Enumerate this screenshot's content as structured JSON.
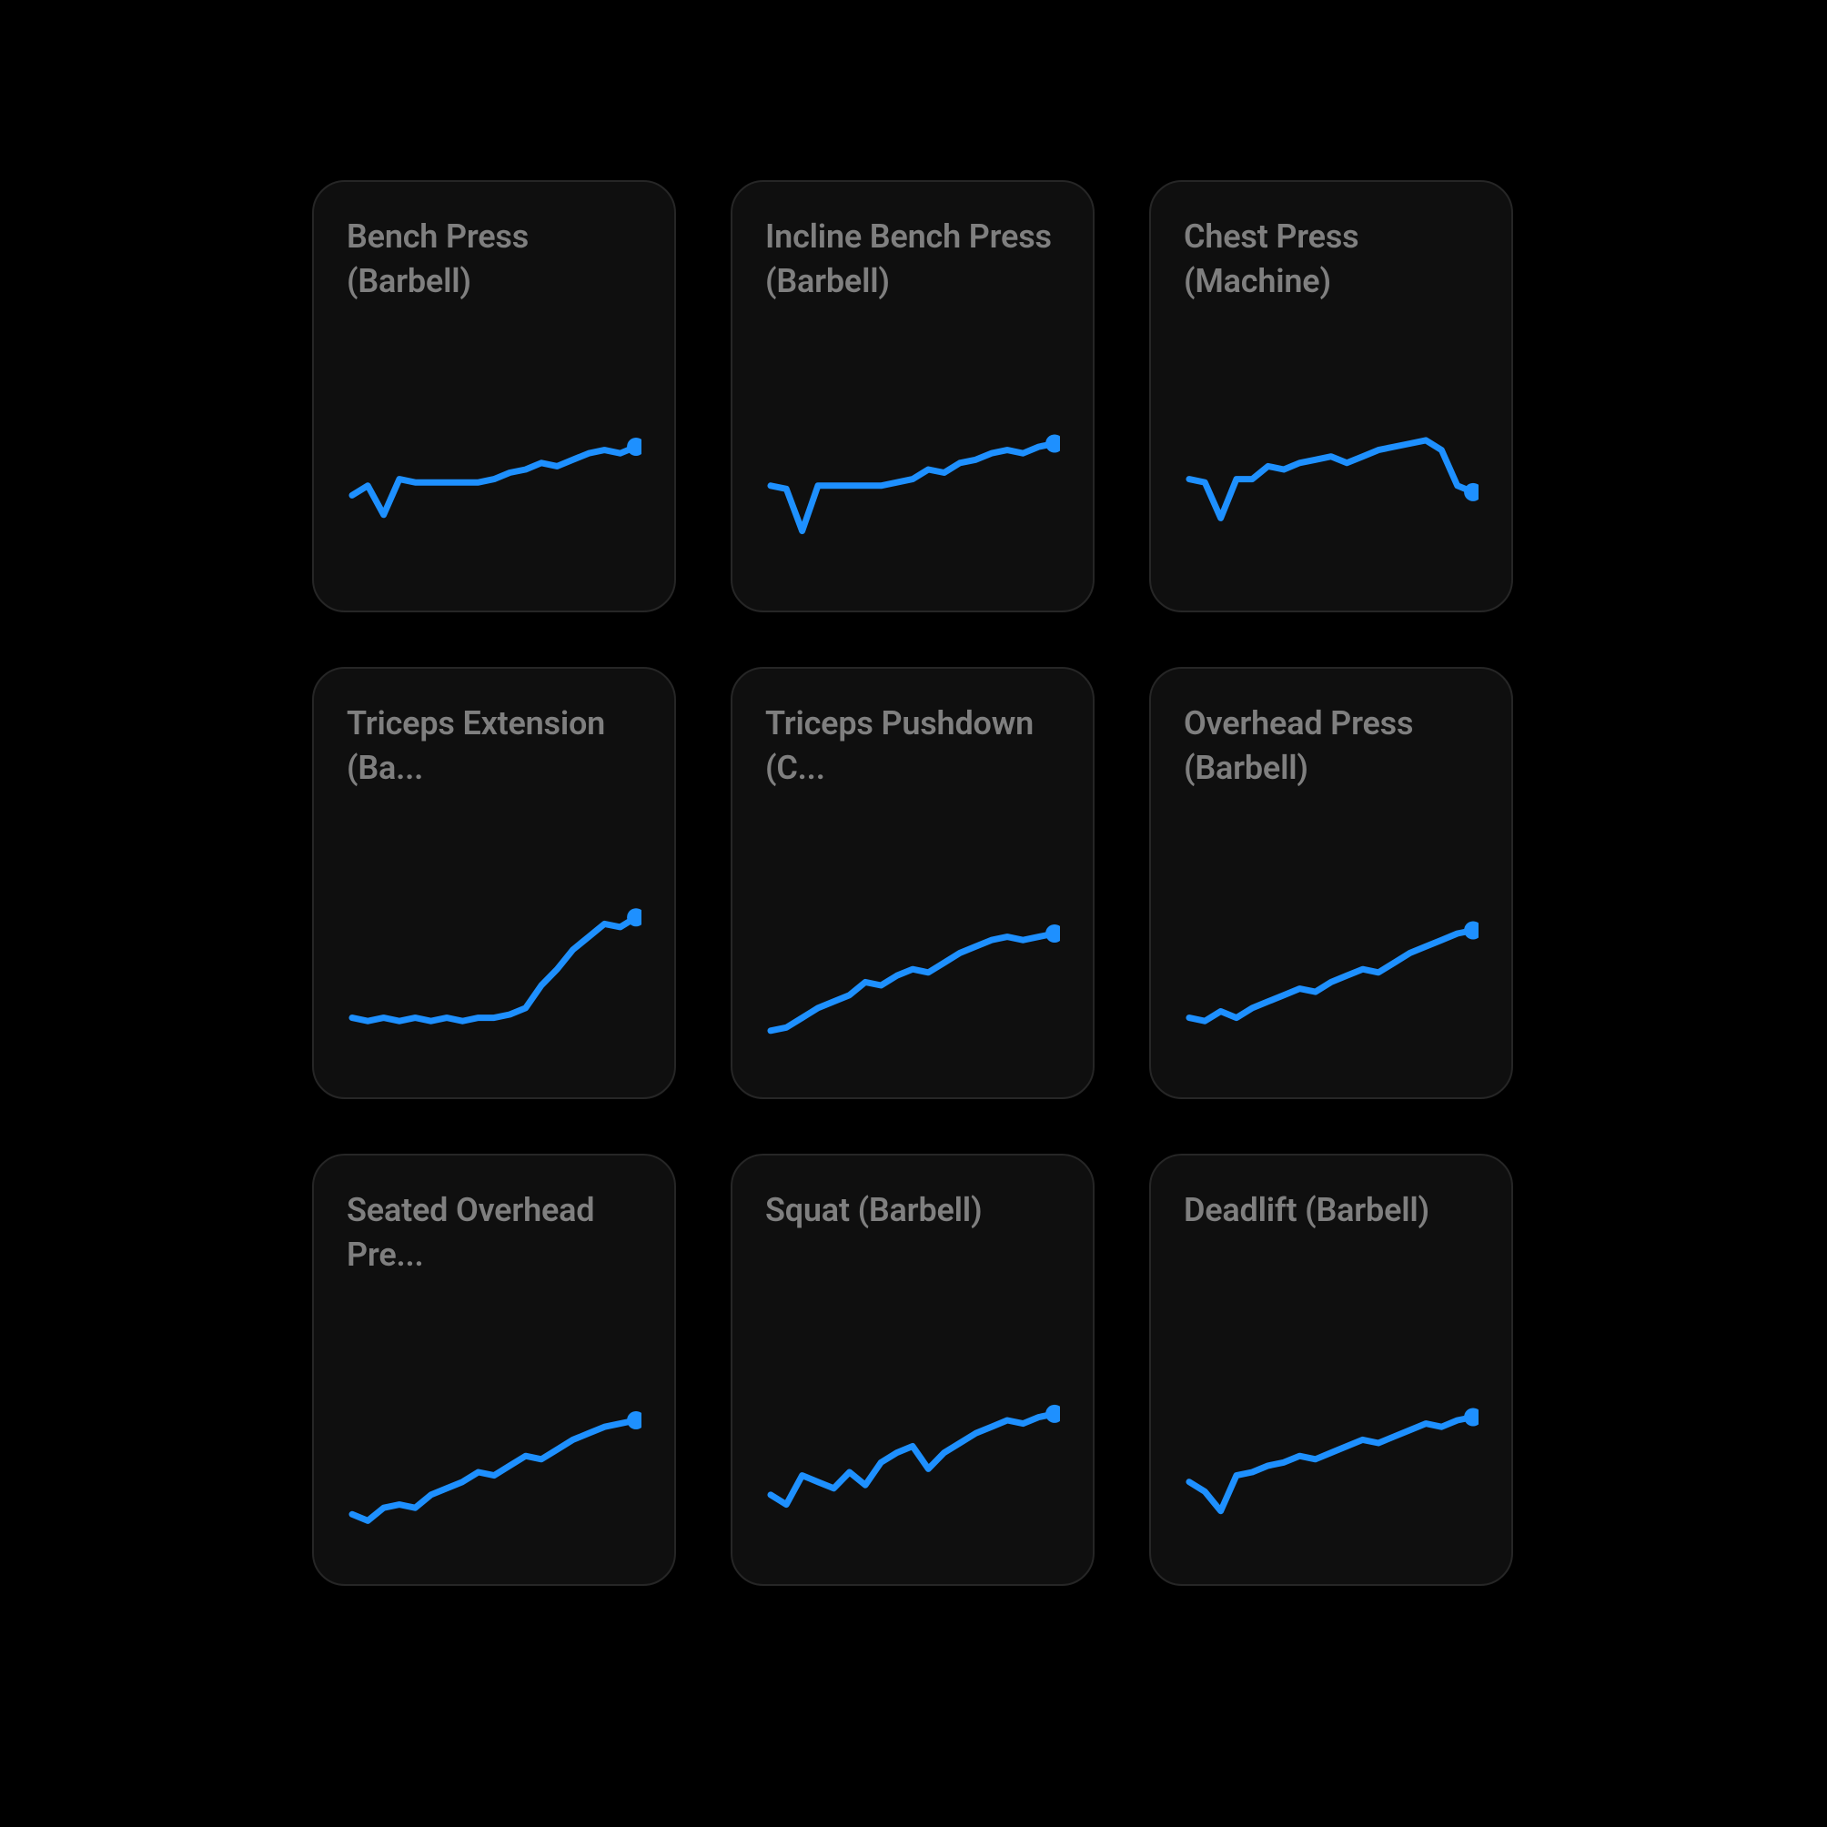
{
  "colors": {
    "accent": "#1e90ff",
    "card_bg": "#0f0f0f",
    "card_border": "#262626",
    "text_muted": "#7f7f7f",
    "background": "#000000"
  },
  "cards": [
    {
      "title": "Bench Press (Barbell)",
      "series": [
        52,
        58,
        40,
        62,
        60,
        60,
        60,
        60,
        60,
        62,
        66,
        68,
        72,
        70,
        74,
        78,
        80,
        78,
        82
      ]
    },
    {
      "title": "Incline Bench Press (Barbell)",
      "series": [
        58,
        56,
        30,
        58,
        58,
        58,
        58,
        58,
        60,
        62,
        68,
        66,
        72,
        74,
        78,
        80,
        78,
        82,
        84
      ]
    },
    {
      "title": "Chest Press (Machine)",
      "series": [
        62,
        60,
        38,
        62,
        62,
        70,
        68,
        72,
        74,
        76,
        72,
        76,
        80,
        82,
        84,
        86,
        80,
        58,
        54
      ]
    },
    {
      "title": "Triceps Extension (Ba...",
      "series": [
        30,
        28,
        30,
        28,
        30,
        28,
        30,
        28,
        30,
        30,
        32,
        36,
        50,
        60,
        72,
        80,
        88,
        86,
        92
      ]
    },
    {
      "title": "Triceps Pushdown (C...",
      "series": [
        22,
        24,
        30,
        36,
        40,
        44,
        52,
        50,
        56,
        60,
        58,
        64,
        70,
        74,
        78,
        80,
        78,
        80,
        82
      ]
    },
    {
      "title": "Overhead Press (Barbell)",
      "series": [
        30,
        28,
        34,
        30,
        36,
        40,
        44,
        48,
        46,
        52,
        56,
        60,
        58,
        64,
        70,
        74,
        78,
        82,
        84
      ]
    },
    {
      "title": "Seated Overhead Pre...",
      "series": [
        24,
        20,
        28,
        30,
        28,
        36,
        40,
        44,
        50,
        48,
        54,
        60,
        58,
        64,
        70,
        74,
        78,
        80,
        82
      ]
    },
    {
      "title": "Squat (Barbell)",
      "series": [
        36,
        30,
        48,
        44,
        40,
        50,
        42,
        56,
        62,
        66,
        52,
        62,
        68,
        74,
        78,
        82,
        80,
        84,
        86
      ]
    },
    {
      "title": "Deadlift (Barbell)",
      "series": [
        44,
        38,
        26,
        48,
        50,
        54,
        56,
        60,
        58,
        62,
        66,
        70,
        68,
        72,
        76,
        80,
        78,
        82,
        84
      ]
    }
  ],
  "chart_data": [
    {
      "type": "line",
      "title": "Bench Press (Barbell)",
      "x": [
        0,
        1,
        2,
        3,
        4,
        5,
        6,
        7,
        8,
        9,
        10,
        11,
        12,
        13,
        14,
        15,
        16,
        17,
        18
      ],
      "values": [
        52,
        58,
        40,
        62,
        60,
        60,
        60,
        60,
        60,
        62,
        66,
        68,
        72,
        70,
        74,
        78,
        80,
        78,
        82
      ],
      "ylim": [
        0,
        100
      ]
    },
    {
      "type": "line",
      "title": "Incline Bench Press (Barbell)",
      "x": [
        0,
        1,
        2,
        3,
        4,
        5,
        6,
        7,
        8,
        9,
        10,
        11,
        12,
        13,
        14,
        15,
        16,
        17,
        18
      ],
      "values": [
        58,
        56,
        30,
        58,
        58,
        58,
        58,
        58,
        60,
        62,
        68,
        66,
        72,
        74,
        78,
        80,
        78,
        82,
        84
      ],
      "ylim": [
        0,
        100
      ]
    },
    {
      "type": "line",
      "title": "Chest Press (Machine)",
      "x": [
        0,
        1,
        2,
        3,
        4,
        5,
        6,
        7,
        8,
        9,
        10,
        11,
        12,
        13,
        14,
        15,
        16,
        17,
        18
      ],
      "values": [
        62,
        60,
        38,
        62,
        62,
        70,
        68,
        72,
        74,
        76,
        72,
        76,
        80,
        82,
        84,
        86,
        80,
        58,
        54
      ],
      "ylim": [
        0,
        100
      ]
    },
    {
      "type": "line",
      "title": "Triceps Extension (Barbell)",
      "x": [
        0,
        1,
        2,
        3,
        4,
        5,
        6,
        7,
        8,
        9,
        10,
        11,
        12,
        13,
        14,
        15,
        16,
        17,
        18
      ],
      "values": [
        30,
        28,
        30,
        28,
        30,
        28,
        30,
        28,
        30,
        30,
        32,
        36,
        50,
        60,
        72,
        80,
        88,
        86,
        92
      ],
      "ylim": [
        0,
        100
      ]
    },
    {
      "type": "line",
      "title": "Triceps Pushdown (Cable)",
      "x": [
        0,
        1,
        2,
        3,
        4,
        5,
        6,
        7,
        8,
        9,
        10,
        11,
        12,
        13,
        14,
        15,
        16,
        17,
        18
      ],
      "values": [
        22,
        24,
        30,
        36,
        40,
        44,
        52,
        50,
        56,
        60,
        58,
        64,
        70,
        74,
        78,
        80,
        78,
        80,
        82
      ],
      "ylim": [
        0,
        100
      ]
    },
    {
      "type": "line",
      "title": "Overhead Press (Barbell)",
      "x": [
        0,
        1,
        2,
        3,
        4,
        5,
        6,
        7,
        8,
        9,
        10,
        11,
        12,
        13,
        14,
        15,
        16,
        17,
        18
      ],
      "values": [
        30,
        28,
        34,
        30,
        36,
        40,
        44,
        48,
        46,
        52,
        56,
        60,
        58,
        64,
        70,
        74,
        78,
        82,
        84
      ],
      "ylim": [
        0,
        100
      ]
    },
    {
      "type": "line",
      "title": "Seated Overhead Press (Dumbbell)",
      "x": [
        0,
        1,
        2,
        3,
        4,
        5,
        6,
        7,
        8,
        9,
        10,
        11,
        12,
        13,
        14,
        15,
        16,
        17,
        18
      ],
      "values": [
        24,
        20,
        28,
        30,
        28,
        36,
        40,
        44,
        50,
        48,
        54,
        60,
        58,
        64,
        70,
        74,
        78,
        80,
        82
      ],
      "ylim": [
        0,
        100
      ]
    },
    {
      "type": "line",
      "title": "Squat (Barbell)",
      "x": [
        0,
        1,
        2,
        3,
        4,
        5,
        6,
        7,
        8,
        9,
        10,
        11,
        12,
        13,
        14,
        15,
        16,
        17,
        18
      ],
      "values": [
        36,
        30,
        48,
        44,
        40,
        50,
        42,
        56,
        62,
        66,
        52,
        62,
        68,
        74,
        78,
        82,
        80,
        84,
        86
      ],
      "ylim": [
        0,
        100
      ]
    },
    {
      "type": "line",
      "title": "Deadlift (Barbell)",
      "x": [
        0,
        1,
        2,
        3,
        4,
        5,
        6,
        7,
        8,
        9,
        10,
        11,
        12,
        13,
        14,
        15,
        16,
        17,
        18
      ],
      "values": [
        44,
        38,
        26,
        48,
        50,
        54,
        56,
        60,
        58,
        62,
        66,
        70,
        68,
        72,
        76,
        80,
        78,
        82,
        84
      ],
      "ylim": [
        0,
        100
      ]
    }
  ]
}
